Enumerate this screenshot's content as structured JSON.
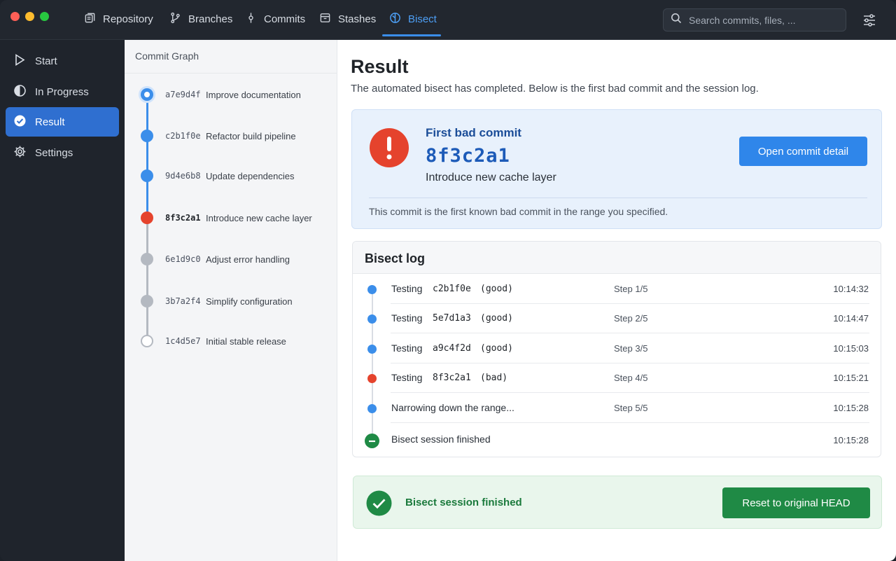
{
  "topbar": {
    "tabs": [
      {
        "label": "Repository",
        "icon": "repository-icon"
      },
      {
        "label": "Branches",
        "icon": "branches-icon"
      },
      {
        "label": "Commits",
        "icon": "commits-icon"
      },
      {
        "label": "Stashes",
        "icon": "stashes-icon"
      },
      {
        "label": "Bisect",
        "icon": "bisect-icon",
        "active": true
      }
    ],
    "search_placeholder": "Search commits, files, ..."
  },
  "sidebar": {
    "items": [
      {
        "label": "Start",
        "icon": "play-icon"
      },
      {
        "label": "In Progress",
        "icon": "progress-icon"
      },
      {
        "label": "Result",
        "icon": "check-circle-icon",
        "active": true
      },
      {
        "label": "Settings",
        "icon": "gear-icon"
      }
    ]
  },
  "graph": {
    "title": "Commit Graph",
    "commits": [
      {
        "hash": "a7e9d4f",
        "message": "Improve documentation",
        "state": "good"
      },
      {
        "hash": "c2b1f0e",
        "message": "Refactor build pipeline",
        "state": "good"
      },
      {
        "hash": "9d4e6b8",
        "message": "Update dependencies",
        "state": "good"
      },
      {
        "hash": "8f3c2a1",
        "message": "Introduce new cache layer",
        "state": "bad"
      },
      {
        "hash": "6e1d9c0",
        "message": "Adjust error handling",
        "state": "untested"
      },
      {
        "hash": "3b7a2f4",
        "message": "Simplify configuration",
        "state": "untested"
      },
      {
        "hash": "1c4d5e7",
        "message": "Initial stable release",
        "state": "origin"
      }
    ]
  },
  "main": {
    "title": "Result",
    "subtitle": "The automated bisect has completed. Below is the first bad commit and the session log.",
    "first_bad": {
      "label": "First bad commit",
      "hash": "8f3c2a1",
      "message": "Introduce new cache layer",
      "note": "This commit is the first known bad commit in the range you specified.",
      "button": "Open commit detail"
    },
    "log": {
      "title": "Bisect log",
      "rows": [
        {
          "action": "Testing",
          "hash": "c2b1f0e",
          "result": "(good)",
          "step": "Step 1/5",
          "time": "10:14:32",
          "status": "good"
        },
        {
          "action": "Testing",
          "hash": "5e7d1a3",
          "result": "(good)",
          "step": "Step 2/5",
          "time": "10:14:47",
          "status": "good"
        },
        {
          "action": "Testing",
          "hash": "a9c4f2d",
          "result": "(good)",
          "step": "Step 3/5",
          "time": "10:15:03",
          "status": "good"
        },
        {
          "action": "Testing",
          "hash": "8f3c2a1",
          "result": "(bad)",
          "step": "Step 4/5",
          "time": "10:15:21",
          "status": "bad"
        },
        {
          "action": "Narrowing down the range...",
          "hash": "",
          "result": "",
          "step": "Step 5/5",
          "time": "10:15:28",
          "status": "good"
        },
        {
          "action": "Bisect session finished",
          "hash": "",
          "result": "",
          "step": "",
          "time": "10:15:28",
          "status": "finished"
        }
      ]
    },
    "done": {
      "text": "Bisect session finished",
      "button": "Reset to original HEAD"
    }
  },
  "colors": {
    "accent": "#2f86ea",
    "good": "#3b8eea",
    "bad": "#e5432d",
    "untested": "#b4b9c1",
    "success": "#1f8a45"
  }
}
